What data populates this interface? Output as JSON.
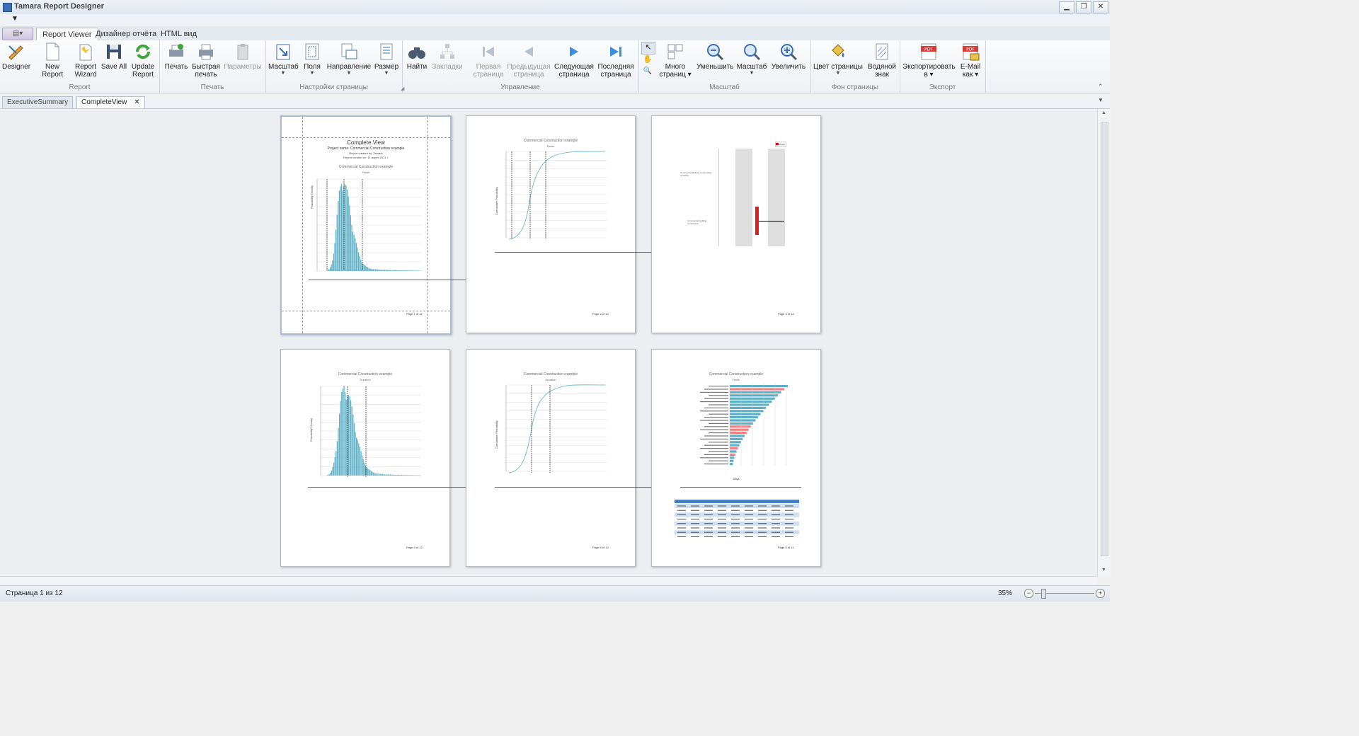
{
  "window": {
    "title": "Tamara Report Designer",
    "min": "▁",
    "restore": "❐",
    "close": "✕"
  },
  "qat": {
    "arrow": "▼"
  },
  "ribbon_tabs": [
    "Report Viewer",
    "Дизайнер отчёта",
    "HTML вид"
  ],
  "groups": {
    "report": {
      "title": "Report",
      "buttons": {
        "designer": "Designer",
        "new_report": "New Report",
        "wizard_1": "Report",
        "wizard_2": "Wizard",
        "save_all": "Save All",
        "update_1": "Update",
        "update_2": "Report"
      }
    },
    "print": {
      "title": "Печать",
      "buttons": {
        "print": "Печать",
        "quick_1": "Быстрая",
        "quick_2": "печать",
        "params": "Параметры"
      }
    },
    "page_setup": {
      "title": "Настройки страницы",
      "buttons": {
        "scale": "Масштаб",
        "margins": "Поля",
        "orientation": "Направление",
        "size": "Размер"
      }
    },
    "navigation": {
      "title": "Управление",
      "buttons": {
        "find": "Найти",
        "bookmarks": "Закладки",
        "first_1": "Первая",
        "first_2": "страница",
        "prev_1": "Предыдущая",
        "prev_2": "страница",
        "next_1": "Следующая",
        "next_2": "страница",
        "last_1": "Последняя",
        "last_2": "страница"
      }
    },
    "zoom": {
      "title": "Масштаб",
      "buttons": {
        "multi_1": "Много",
        "multi_2": "страниц",
        "zoom_out": "Уменьшить",
        "zoom": "Масштаб",
        "zoom_in": "Увеличить"
      }
    },
    "background": {
      "title": "Фон страницы",
      "buttons": {
        "color": "Цвет страницы",
        "watermark_1": "Водяной",
        "watermark_2": "знак"
      }
    },
    "export": {
      "title": "Экспорт",
      "buttons": {
        "export_1": "Экспортировать",
        "export_2": "в",
        "email_1": "E-Mail",
        "email_2": "как",
        "pdf": "PDF"
      }
    }
  },
  "doc_tabs": [
    "ExecutiveSummary",
    "CompleteView"
  ],
  "doc_tab_close": "✕",
  "pages": {
    "p1": {
      "title": "Complete View",
      "project": "Project name: Commercial Construction example",
      "created_by": "Report created by: Tamara",
      "created_on": "Report created on: 11 марта 2021 г.",
      "chart_title": "Commercial Construction example",
      "chart_sub": "Finish",
      "ylabel": "Probability Density",
      "footer": "Page 1 of 12"
    },
    "p2": {
      "chart_title": "Commercial Construction example",
      "chart_sub": "Finish",
      "ylabel": "Cumulative Probability",
      "footer": "Page 2 of 12"
    },
    "p3": {
      "legend": "Finish",
      "row1": "Commercial building construction complete",
      "row2": "Commercial building construction",
      "footer": "Page 3 of 12"
    },
    "p4": {
      "chart_title": "Commercial Construction example",
      "chart_sub": "Duration",
      "ylabel": "Probability Density",
      "footer": "Page 4 of 12"
    },
    "p5": {
      "chart_title": "Commercial Construction example",
      "chart_sub": "Duration",
      "ylabel": "Cumulative Probability",
      "footer": "Page 5 of 12"
    },
    "p6": {
      "chart_title": "Commercial Construction example",
      "chart_sub": "Finish",
      "xlabel": "Days",
      "footer": "Page 6 of 12"
    }
  },
  "status": {
    "page_info": "Страница 1 из 12",
    "zoom": "35%",
    "zoom_minus": "−",
    "zoom_plus": "+"
  },
  "colors": {
    "bars": "#5bafc6",
    "red_bar": "#f08080",
    "accent": "#3b6fb6",
    "table_head": "#4a7fc4",
    "table_row": "#cfe0f5"
  }
}
